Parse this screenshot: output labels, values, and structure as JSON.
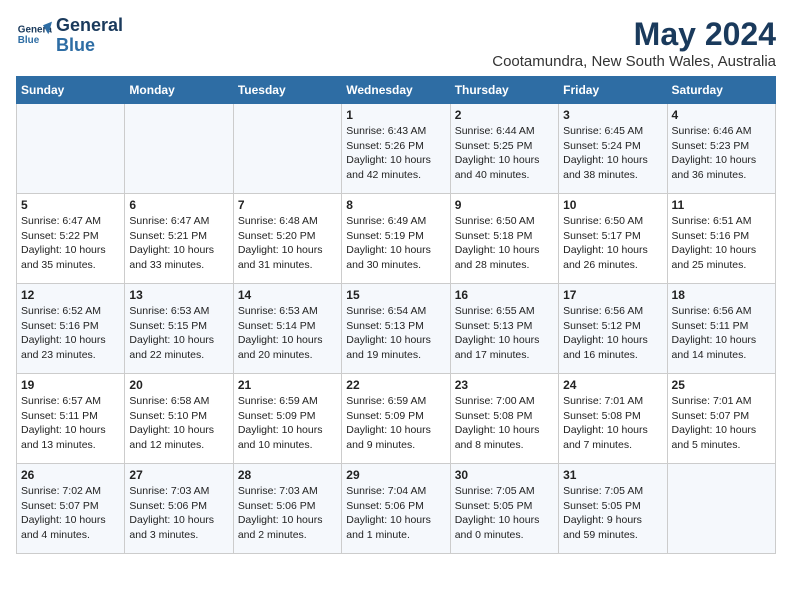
{
  "logo": {
    "text_line1": "General",
    "text_line2": "Blue"
  },
  "title": "May 2024",
  "subtitle": "Cootamundra, New South Wales, Australia",
  "days_of_week": [
    "Sunday",
    "Monday",
    "Tuesday",
    "Wednesday",
    "Thursday",
    "Friday",
    "Saturday"
  ],
  "weeks": [
    [
      {
        "day": "",
        "content": ""
      },
      {
        "day": "",
        "content": ""
      },
      {
        "day": "",
        "content": ""
      },
      {
        "day": "1",
        "content": "Sunrise: 6:43 AM\nSunset: 5:26 PM\nDaylight: 10 hours\nand 42 minutes."
      },
      {
        "day": "2",
        "content": "Sunrise: 6:44 AM\nSunset: 5:25 PM\nDaylight: 10 hours\nand 40 minutes."
      },
      {
        "day": "3",
        "content": "Sunrise: 6:45 AM\nSunset: 5:24 PM\nDaylight: 10 hours\nand 38 minutes."
      },
      {
        "day": "4",
        "content": "Sunrise: 6:46 AM\nSunset: 5:23 PM\nDaylight: 10 hours\nand 36 minutes."
      }
    ],
    [
      {
        "day": "5",
        "content": "Sunrise: 6:47 AM\nSunset: 5:22 PM\nDaylight: 10 hours\nand 35 minutes."
      },
      {
        "day": "6",
        "content": "Sunrise: 6:47 AM\nSunset: 5:21 PM\nDaylight: 10 hours\nand 33 minutes."
      },
      {
        "day": "7",
        "content": "Sunrise: 6:48 AM\nSunset: 5:20 PM\nDaylight: 10 hours\nand 31 minutes."
      },
      {
        "day": "8",
        "content": "Sunrise: 6:49 AM\nSunset: 5:19 PM\nDaylight: 10 hours\nand 30 minutes."
      },
      {
        "day": "9",
        "content": "Sunrise: 6:50 AM\nSunset: 5:18 PM\nDaylight: 10 hours\nand 28 minutes."
      },
      {
        "day": "10",
        "content": "Sunrise: 6:50 AM\nSunset: 5:17 PM\nDaylight: 10 hours\nand 26 minutes."
      },
      {
        "day": "11",
        "content": "Sunrise: 6:51 AM\nSunset: 5:16 PM\nDaylight: 10 hours\nand 25 minutes."
      }
    ],
    [
      {
        "day": "12",
        "content": "Sunrise: 6:52 AM\nSunset: 5:16 PM\nDaylight: 10 hours\nand 23 minutes."
      },
      {
        "day": "13",
        "content": "Sunrise: 6:53 AM\nSunset: 5:15 PM\nDaylight: 10 hours\nand 22 minutes."
      },
      {
        "day": "14",
        "content": "Sunrise: 6:53 AM\nSunset: 5:14 PM\nDaylight: 10 hours\nand 20 minutes."
      },
      {
        "day": "15",
        "content": "Sunrise: 6:54 AM\nSunset: 5:13 PM\nDaylight: 10 hours\nand 19 minutes."
      },
      {
        "day": "16",
        "content": "Sunrise: 6:55 AM\nSunset: 5:13 PM\nDaylight: 10 hours\nand 17 minutes."
      },
      {
        "day": "17",
        "content": "Sunrise: 6:56 AM\nSunset: 5:12 PM\nDaylight: 10 hours\nand 16 minutes."
      },
      {
        "day": "18",
        "content": "Sunrise: 6:56 AM\nSunset: 5:11 PM\nDaylight: 10 hours\nand 14 minutes."
      }
    ],
    [
      {
        "day": "19",
        "content": "Sunrise: 6:57 AM\nSunset: 5:11 PM\nDaylight: 10 hours\nand 13 minutes."
      },
      {
        "day": "20",
        "content": "Sunrise: 6:58 AM\nSunset: 5:10 PM\nDaylight: 10 hours\nand 12 minutes."
      },
      {
        "day": "21",
        "content": "Sunrise: 6:59 AM\nSunset: 5:09 PM\nDaylight: 10 hours\nand 10 minutes."
      },
      {
        "day": "22",
        "content": "Sunrise: 6:59 AM\nSunset: 5:09 PM\nDaylight: 10 hours\nand 9 minutes."
      },
      {
        "day": "23",
        "content": "Sunrise: 7:00 AM\nSunset: 5:08 PM\nDaylight: 10 hours\nand 8 minutes."
      },
      {
        "day": "24",
        "content": "Sunrise: 7:01 AM\nSunset: 5:08 PM\nDaylight: 10 hours\nand 7 minutes."
      },
      {
        "day": "25",
        "content": "Sunrise: 7:01 AM\nSunset: 5:07 PM\nDaylight: 10 hours\nand 5 minutes."
      }
    ],
    [
      {
        "day": "26",
        "content": "Sunrise: 7:02 AM\nSunset: 5:07 PM\nDaylight: 10 hours\nand 4 minutes."
      },
      {
        "day": "27",
        "content": "Sunrise: 7:03 AM\nSunset: 5:06 PM\nDaylight: 10 hours\nand 3 minutes."
      },
      {
        "day": "28",
        "content": "Sunrise: 7:03 AM\nSunset: 5:06 PM\nDaylight: 10 hours\nand 2 minutes."
      },
      {
        "day": "29",
        "content": "Sunrise: 7:04 AM\nSunset: 5:06 PM\nDaylight: 10 hours\nand 1 minute."
      },
      {
        "day": "30",
        "content": "Sunrise: 7:05 AM\nSunset: 5:05 PM\nDaylight: 10 hours\nand 0 minutes."
      },
      {
        "day": "31",
        "content": "Sunrise: 7:05 AM\nSunset: 5:05 PM\nDaylight: 9 hours\nand 59 minutes."
      },
      {
        "day": "",
        "content": ""
      }
    ]
  ]
}
